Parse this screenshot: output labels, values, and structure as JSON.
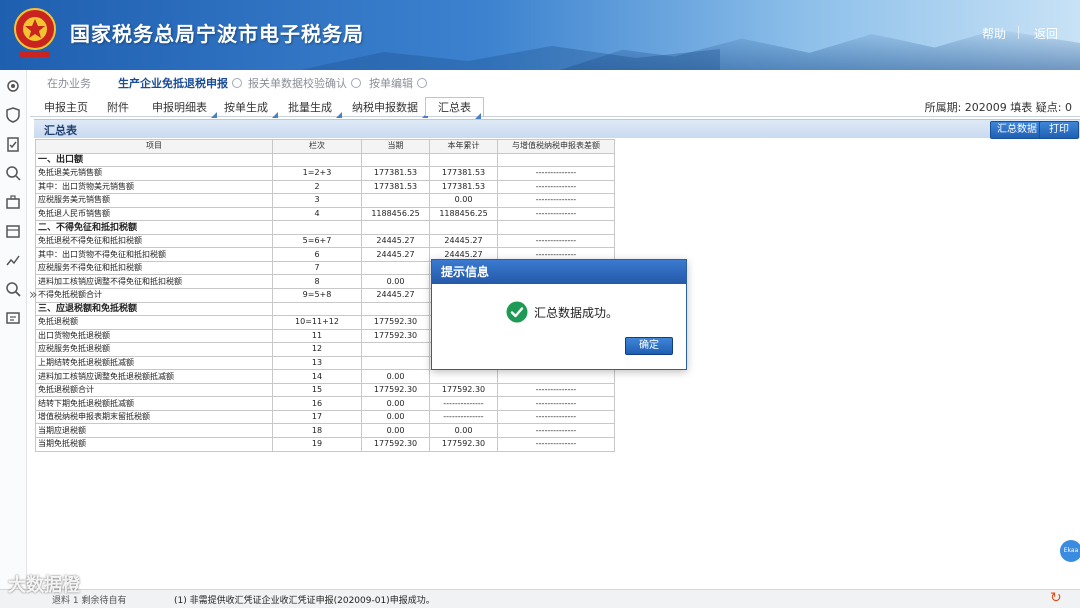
{
  "header": {
    "title": "国家税务总局宁波市电子税务局",
    "help": "帮助",
    "back": "返回"
  },
  "breadcrumbs": [
    {
      "label": "在办业务"
    },
    {
      "label": "生产企业免抵退税申报"
    },
    {
      "label": "报关单数据校验确认"
    },
    {
      "label": "按单编辑"
    }
  ],
  "tabs": [
    {
      "label": "申报主页"
    },
    {
      "label": "附件"
    },
    {
      "label": "申报明细表"
    },
    {
      "label": "按单生成"
    },
    {
      "label": "批量生成"
    },
    {
      "label": "纳税申报数据"
    },
    {
      "label": "汇总表"
    }
  ],
  "period": "所属期: 202009  填表  疑点: 0",
  "panel": {
    "title": "汇总表",
    "sum_button": "汇总数据",
    "print_button": "打印"
  },
  "table": {
    "headers": [
      "项目",
      "栏次",
      "当期",
      "本年累计",
      "与增值税纳税申报表差额"
    ],
    "rows": [
      {
        "item": "一、出口额",
        "section": true
      },
      {
        "item": "免抵退美元销售额",
        "col": "1=2+3",
        "cur": "177381.53",
        "ytd": "177381.53",
        "diff": "--------------"
      },
      {
        "item": "其中：出口货物美元销售额",
        "col": "2",
        "cur": "177381.53",
        "ytd": "177381.53",
        "diff": "--------------"
      },
      {
        "item": "应税服务美元销售额",
        "col": "3",
        "cur": "",
        "ytd": "0.00",
        "diff": "--------------"
      },
      {
        "item": "免抵退人民币销售额",
        "col": "4",
        "cur": "1188456.25",
        "ytd": "1188456.25",
        "diff": "--------------"
      },
      {
        "item": "二、不得免征和抵扣税额",
        "section": true
      },
      {
        "item": "免抵退税不得免征和抵扣税额",
        "col": "5=6+7",
        "cur": "24445.27",
        "ytd": "24445.27",
        "diff": "--------------"
      },
      {
        "item": "其中：出口货物不得免征和抵扣税额",
        "col": "6",
        "cur": "24445.27",
        "ytd": "24445.27",
        "diff": "--------------"
      },
      {
        "item": "应税服务不得免征和抵扣税额",
        "col": "7",
        "cur": "",
        "ytd": "",
        "diff": ""
      },
      {
        "item": "进料加工核销应调整不得免征和抵扣税额",
        "col": "8",
        "cur": "0.00",
        "ytd": "",
        "diff": ""
      },
      {
        "item": "不得免抵税额合计",
        "col": "9=5+8",
        "cur": "24445.27",
        "ytd": "",
        "diff": ""
      },
      {
        "item": "三、应退税额和免抵税额",
        "section": true
      },
      {
        "item": "免抵退税额",
        "col": "10=11+12",
        "cur": "177592.30",
        "ytd": "",
        "diff": ""
      },
      {
        "item": "出口货物免抵退税额",
        "col": "11",
        "cur": "177592.30",
        "ytd": "",
        "diff": ""
      },
      {
        "item": "应税服务免抵退税额",
        "col": "12",
        "cur": "",
        "ytd": "",
        "diff": ""
      },
      {
        "item": "上期结转免抵退税额抵减额",
        "col": "13",
        "cur": "",
        "ytd": "",
        "diff": ""
      },
      {
        "item": "进料加工核销应调整免抵退税额抵减额",
        "col": "14",
        "cur": "0.00",
        "ytd": "",
        "diff": ""
      },
      {
        "item": "免抵退税额合计",
        "col": "15",
        "cur": "177592.30",
        "ytd": "177592.30",
        "diff": "--------------"
      },
      {
        "item": "结转下期免抵退税额抵减额",
        "col": "16",
        "cur": "0.00",
        "ytd": "--------------",
        "diff": "--------------"
      },
      {
        "item": "增值税纳税申报表期末留抵税额",
        "col": "17",
        "cur": "0.00",
        "ytd": "--------------",
        "diff": "--------------"
      },
      {
        "item": "当期应退税额",
        "col": "18",
        "cur": "0.00",
        "ytd": "0.00",
        "diff": "--------------"
      },
      {
        "item": "当期免抵税额",
        "col": "19",
        "cur": "177592.30",
        "ytd": "177592.30",
        "diff": "--------------"
      }
    ]
  },
  "dialog": {
    "title": "提示信息",
    "message": "汇总数据成功。",
    "ok": "确定"
  },
  "status": {
    "message": "(1)  非需提供收汇凭证企业收汇凭证申报(202009-01)申报成功。",
    "left": "退料 1 剩余待自有"
  },
  "watermark": "大数据橙",
  "float_button": "Ekaa",
  "colors": {
    "header_start": "#1f5fb0",
    "dialog_header": "#2459a8",
    "success": "#1f9a55",
    "button": "#1f5fb3"
  }
}
